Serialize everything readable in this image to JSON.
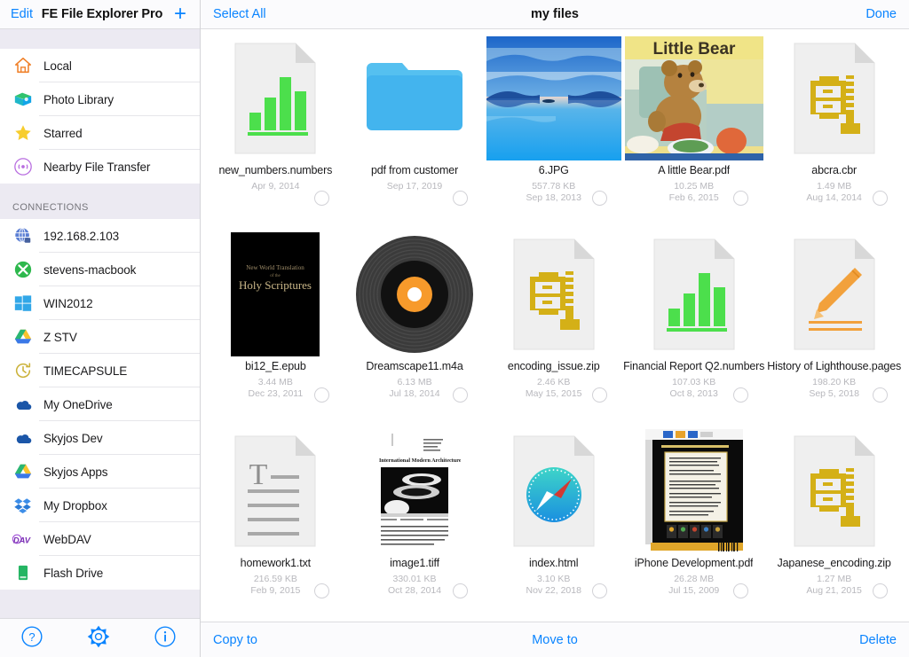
{
  "sidebar": {
    "header": {
      "edit_label": "Edit",
      "title": "FE File Explorer Pro",
      "add_label": "+"
    },
    "places": [
      {
        "label": "Local",
        "icon": "home-icon"
      },
      {
        "label": "Photo Library",
        "icon": "photo-library-icon"
      },
      {
        "label": "Starred",
        "icon": "star-icon"
      },
      {
        "label": "Nearby File Transfer",
        "icon": "nearby-transfer-icon"
      }
    ],
    "connections_header": "CONNECTIONS",
    "connections": [
      {
        "label": "192.168.2.103",
        "icon": "network-globe-icon"
      },
      {
        "label": "stevens-macbook",
        "icon": "xbmc-green-icon"
      },
      {
        "label": "WIN2012",
        "icon": "windows-icon"
      },
      {
        "label": "Z STV",
        "icon": "google-drive-icon"
      },
      {
        "label": "TIMECAPSULE",
        "icon": "time-machine-icon"
      },
      {
        "label": "My OneDrive",
        "icon": "onedrive-icon"
      },
      {
        "label": "Skyjos Dev",
        "icon": "onedrive-icon"
      },
      {
        "label": "Skyjos Apps",
        "icon": "google-drive-icon"
      },
      {
        "label": "My Dropbox",
        "icon": "dropbox-icon"
      },
      {
        "label": "WebDAV",
        "icon": "webdav-icon"
      },
      {
        "label": "Flash Drive",
        "icon": "flash-drive-icon"
      }
    ],
    "footer": [
      {
        "icon": "help-icon"
      },
      {
        "icon": "gear-icon"
      },
      {
        "icon": "info-icon"
      }
    ]
  },
  "topbar": {
    "select_all_label": "Select All",
    "title": "my files",
    "done_label": "Done"
  },
  "files": [
    {
      "name": "new_numbers.numbers",
      "size": "",
      "date": "Apr 9, 2014",
      "thumb": "numbers-doc-icon"
    },
    {
      "name": "pdf from customer",
      "size": "",
      "date": "Sep 17, 2019",
      "thumb": "folder-icon"
    },
    {
      "name": "6.JPG",
      "size": "557.78 KB",
      "date": "Sep 18, 2013",
      "thumb": "lake-photo-thumb"
    },
    {
      "name": "A little Bear.pdf",
      "size": "10.25 MB",
      "date": "Feb 6, 2015",
      "thumb": "little-bear-cover-thumb"
    },
    {
      "name": "abcra.cbr",
      "size": "1.49 MB",
      "date": "Aug 14, 2014",
      "thumb": "archive-doc-icon"
    },
    {
      "name": "bi12_E.epub",
      "size": "3.44 MB",
      "date": "Dec 23, 2011",
      "thumb": "epub-book-cover-thumb"
    },
    {
      "name": "Dreamscape11.m4a",
      "size": "6.13 MB",
      "date": "Jul 18, 2014",
      "thumb": "vinyl-record-icon"
    },
    {
      "name": "encoding_issue.zip",
      "size": "2.46 KB",
      "date": "May 15, 2015",
      "thumb": "archive-doc-icon"
    },
    {
      "name": "Financial Report  Q2.numbers",
      "size": "107.03 KB",
      "date": "Oct 8, 2013",
      "thumb": "numbers-doc-icon"
    },
    {
      "name": "History of Lighthouse.pages",
      "size": "198.20 KB",
      "date": "Sep 5, 2018",
      "thumb": "pages-doc-icon"
    },
    {
      "name": "homework1.txt",
      "size": "216.59 KB",
      "date": "Feb 9, 2015",
      "thumb": "text-doc-icon"
    },
    {
      "name": "image1.tiff",
      "size": "330.01 KB",
      "date": "Oct 28, 2014",
      "thumb": "scanned-article-thumb"
    },
    {
      "name": "index.html",
      "size": "3.10 KB",
      "date": "Nov 22, 2018",
      "thumb": "safari-doc-icon"
    },
    {
      "name": "iPhone Development.pdf",
      "size": "26.28 MB",
      "date": "Jul 15, 2009",
      "thumb": "apress-book-back-thumb"
    },
    {
      "name": "Japanese_encoding.zip",
      "size": "1.27 MB",
      "date": "Aug 21, 2015",
      "thumb": "archive-doc-icon"
    }
  ],
  "bottombar": {
    "copy_to_label": "Copy to",
    "move_to_label": "Move to",
    "delete_label": "Delete"
  },
  "colors": {
    "accent": "#0a84ff",
    "sidebar_section_bg": "#eceaf2",
    "archive_yellow": "#d4b017",
    "numbers_green": "#4cdf4c"
  },
  "scanned_article": {
    "title": "International Modern Architecture"
  },
  "epub_cover": {
    "line1": "New World Translation",
    "line2": "of the",
    "line3": "Holy Scriptures"
  },
  "little_bear_cover": {
    "title": "Little Bear"
  }
}
